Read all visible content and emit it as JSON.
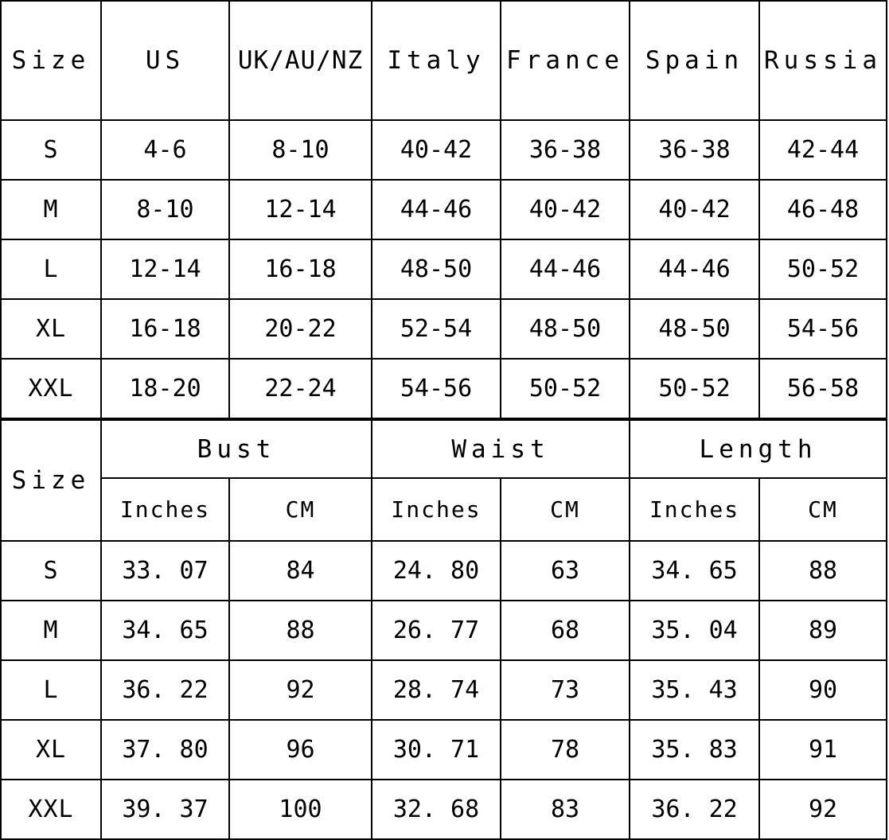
{
  "colors": {
    "header_background": "#afbccd",
    "border": "#000000",
    "cell_background": "#ffffff",
    "text": "#000000"
  },
  "conversion_table": {
    "headers": [
      "Size",
      "US",
      "UK/AU/NZ",
      "Italy",
      "France",
      "Spain",
      "Russia"
    ],
    "rows": [
      {
        "size": "S",
        "us": "4-6",
        "uk_au_nz": "8-10",
        "italy": "40-42",
        "france": "36-38",
        "spain": "36-38",
        "russia": "42-44"
      },
      {
        "size": "M",
        "us": "8-10",
        "uk_au_nz": "12-14",
        "italy": "44-46",
        "france": "40-42",
        "spain": "40-42",
        "russia": "46-48"
      },
      {
        "size": "L",
        "us": "12-14",
        "uk_au_nz": "16-18",
        "italy": "48-50",
        "france": "44-46",
        "spain": "44-46",
        "russia": "50-52"
      },
      {
        "size": "XL",
        "us": "16-18",
        "uk_au_nz": "20-22",
        "italy": "52-54",
        "france": "48-50",
        "spain": "48-50",
        "russia": "54-56"
      },
      {
        "size": "XXL",
        "us": "18-20",
        "uk_au_nz": "22-24",
        "italy": "54-56",
        "france": "50-52",
        "spain": "50-52",
        "russia": "56-58"
      }
    ]
  },
  "measurement_table": {
    "size_header": "Size",
    "groups": [
      "Bust",
      "Waist",
      "Length"
    ],
    "subheaders": [
      "Inches",
      "CM",
      "Inches",
      "CM",
      "Inches",
      "CM"
    ],
    "unit_inches": "Inches",
    "unit_cm": "CM",
    "rows": [
      {
        "size": "S",
        "bust_in": "33. 07",
        "bust_cm": "84",
        "waist_in": "24. 80",
        "waist_cm": "63",
        "length_in": "34. 65",
        "length_cm": "88"
      },
      {
        "size": "M",
        "bust_in": "34. 65",
        "bust_cm": "88",
        "waist_in": "26. 77",
        "waist_cm": "68",
        "length_in": "35. 04",
        "length_cm": "89"
      },
      {
        "size": "L",
        "bust_in": "36. 22",
        "bust_cm": "92",
        "waist_in": "28. 74",
        "waist_cm": "73",
        "length_in": "35. 43",
        "length_cm": "90"
      },
      {
        "size": "XL",
        "bust_in": "37. 80",
        "bust_cm": "96",
        "waist_in": "30. 71",
        "waist_cm": "78",
        "length_in": "35. 83",
        "length_cm": "91"
      },
      {
        "size": "XXL",
        "bust_in": "39. 37",
        "bust_cm": "100",
        "waist_in": "32. 68",
        "waist_cm": "83",
        "length_in": "36. 22",
        "length_cm": "92"
      }
    ]
  }
}
